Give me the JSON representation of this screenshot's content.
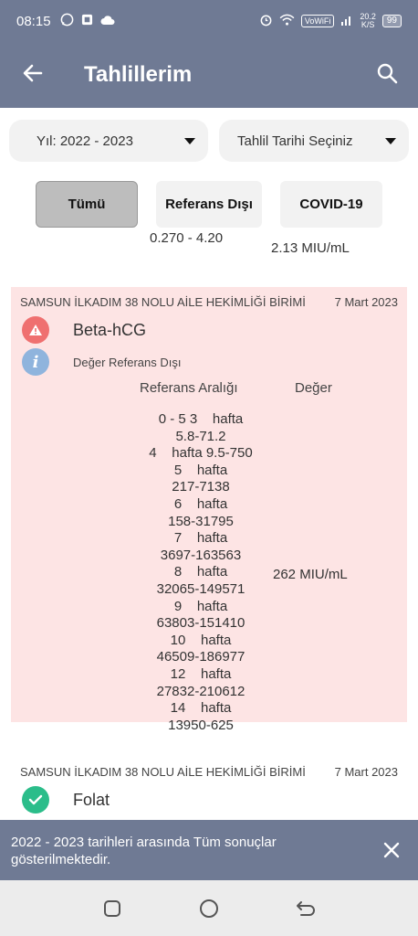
{
  "status_bar": {
    "time": "08:15",
    "vowifi": "VoWiFi",
    "speed": "20.2",
    "speed_unit": "K/S",
    "battery": "99"
  },
  "appbar": {
    "title": "Tahlillerim",
    "back_icon": "arrow-left-icon",
    "search_icon": "search-icon",
    "color": "#6f7a94"
  },
  "filters": {
    "year": "Yıl: 2022 - 2023",
    "date": "Tahlil Tarihi Seçiniz"
  },
  "tabs": [
    {
      "label": "Tümü",
      "active": true
    },
    {
      "label": "Referans Dışı",
      "active": false
    },
    {
      "label": "COVID-19",
      "active": false
    }
  ],
  "partial_row": {
    "reference": "0.270 - 4.20",
    "value": "2.13 MIU/mL"
  },
  "cards": [
    {
      "institution": "SAMSUN İLKADIM 38 NOLU AİLE HEKİMLİĞİ BİRİMİ",
      "date": "7 Mart 2023",
      "test_name": "Beta-hCG",
      "status_text": "Değer Referans Dışı",
      "ref_header": "Referans Aralığı",
      "value_header": "Değer",
      "reference_range": "0 - 5 3    hafta\n5.8-71.2\n4    hafta 9.5-750\n5    hafta\n217-7138\n6    hafta\n158-31795\n7    hafta\n3697-163563\n8    hafta\n32065-149571\n9    hafta\n63803-151410\n10    hafta\n46509-186977\n12    hafta\n27832-210612\n14    hafta\n13950-625",
      "value": "262 MIU/mL",
      "background": "#fde4e4"
    },
    {
      "institution": "SAMSUN İLKADIM 38 NOLU AİLE HEKİMLİĞİ BİRİMİ",
      "date": "7 Mart 2023",
      "test_name": "Folat"
    }
  ],
  "snackbar": {
    "message": "2022 - 2023 tarihleri arasında Tüm sonuçlar gösterilmektedir."
  }
}
